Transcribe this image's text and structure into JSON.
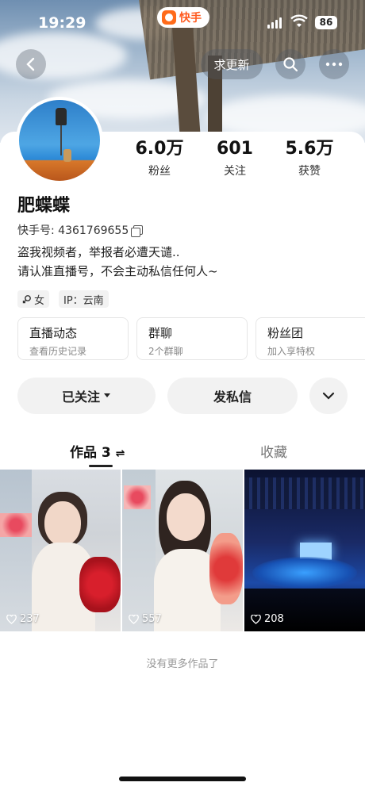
{
  "status_bar": {
    "time": "19:29",
    "app_name": "快手",
    "battery": "86"
  },
  "nav": {
    "update_label": "求更新",
    "back_icon": "chevron-left-icon",
    "search_icon": "search-icon",
    "more_icon": "more-icon"
  },
  "profile": {
    "stats": [
      {
        "value": "6.0万",
        "label": "粉丝"
      },
      {
        "value": "601",
        "label": "关注"
      },
      {
        "value": "5.6万",
        "label": "获赞"
      }
    ],
    "name": "肥蝶蝶",
    "kuaishou_id": "快手号: 4361769655",
    "bio_line1": "盗我视频者，举报者必遭天谴..",
    "bio_line2": "请认准直播号，不会主动私信任何人~",
    "tag_gender": "女",
    "tag_ip": "IP：云南"
  },
  "features": [
    {
      "title": "直播动态",
      "subtitle": "查看历史记录"
    },
    {
      "title": "群聊",
      "subtitle": "2个群聊"
    },
    {
      "title": "粉丝团",
      "subtitle": "加入享特权"
    }
  ],
  "actions": {
    "following": "已关注",
    "message": "发私信"
  },
  "tabs": {
    "works": "作品 3",
    "works_sort_icon": "⇌",
    "collection": "收藏"
  },
  "works": [
    {
      "likes": "237"
    },
    {
      "likes": "557"
    },
    {
      "likes": "208"
    }
  ],
  "footer": {
    "no_more": "没有更多作品了"
  },
  "colors": {
    "brand": "#ff6b1a",
    "background": "#ffffff",
    "chip": "#f2f2f2"
  }
}
